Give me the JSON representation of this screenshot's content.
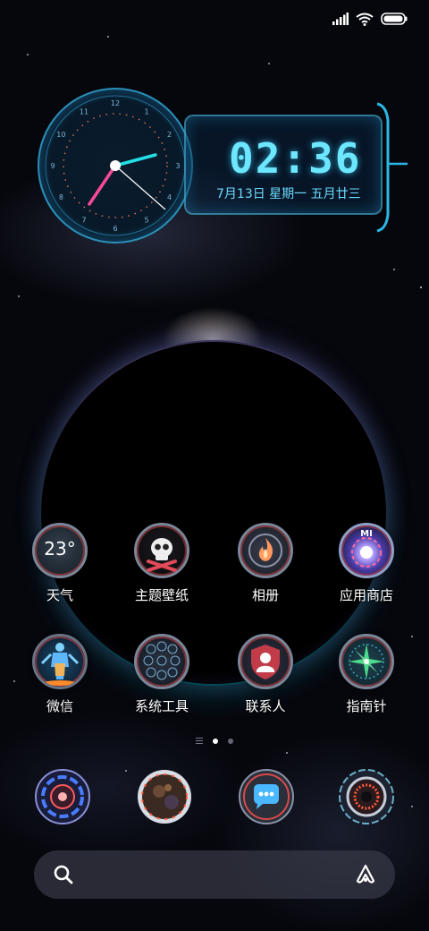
{
  "status_bar": {
    "icons": [
      "signal-icon",
      "wifi-icon",
      "battery-icon"
    ]
  },
  "clock_widget": {
    "time": "02:36",
    "date": "7月13日 星期一 五月廿三",
    "dial_numbers": [
      "12",
      "1",
      "2",
      "3",
      "4",
      "5",
      "6",
      "7",
      "8",
      "9",
      "10",
      "11"
    ]
  },
  "apps": {
    "weather": {
      "label": "天气",
      "temp": "23°"
    },
    "themes": {
      "label": "主题壁纸"
    },
    "gallery": {
      "label": "相册"
    },
    "app_store": {
      "label": "应用商店",
      "badge": "MI"
    },
    "wechat": {
      "label": "微信"
    },
    "system_tools": {
      "label": "系统工具"
    },
    "contacts": {
      "label": "联系人"
    },
    "compass": {
      "label": "指南针"
    }
  },
  "page_indicator": {
    "pages": 2,
    "current": 1
  },
  "dock": [
    "phone-app-icon",
    "browser-app-icon",
    "messages-app-icon",
    "camera-app-icon"
  ],
  "search_bar": {
    "placeholder": ""
  },
  "colors": {
    "accent_cyan": "#6de7ff",
    "ring_red": "#c84646",
    "background": "#06070d"
  }
}
